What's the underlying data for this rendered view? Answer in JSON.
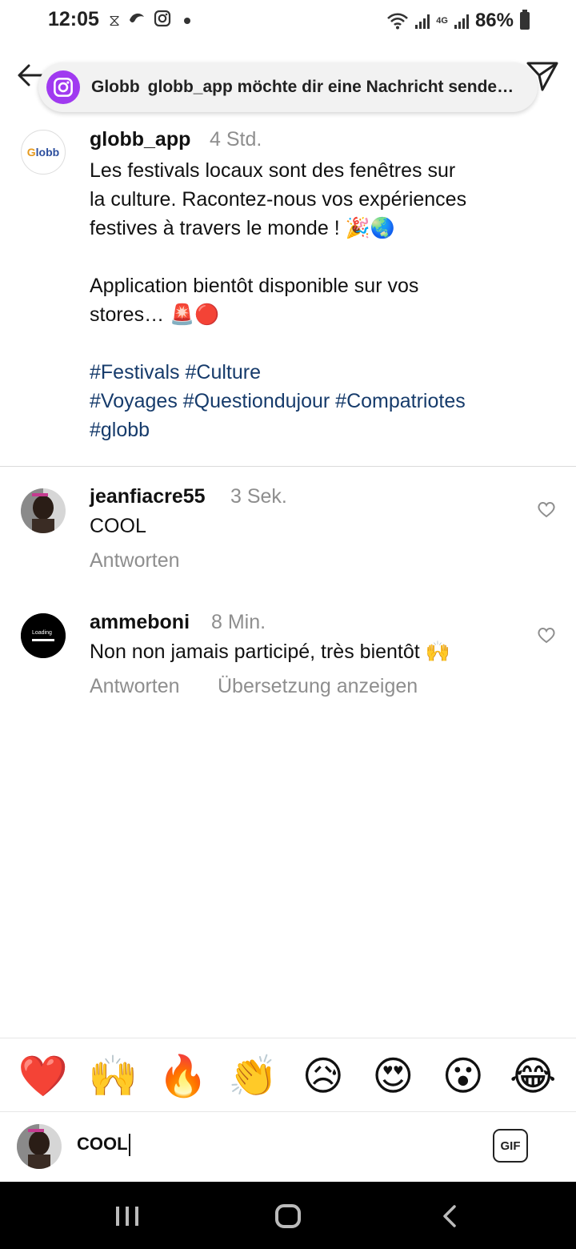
{
  "status_bar": {
    "time": "12:05",
    "battery": "86%",
    "network": "4G",
    "left_icons": [
      "hourglass-icon",
      "bird-icon",
      "instagram-icon",
      "dot-icon"
    ]
  },
  "header": {
    "notification_app": "Globb",
    "notification_message": "globb_app möchte dir eine Nachricht sende…"
  },
  "post": {
    "username": "globb_app",
    "time": "4 Std.",
    "avatar_text": "Globb",
    "lines": [
      "Les festivals locaux sont des fenêtres sur",
      "la culture. Racontez-nous vos expériences",
      "festives à travers le monde ! 🎉🌏",
      "",
      "Application bientôt disponible sur vos",
      "stores… 🚨🔴"
    ],
    "hashtag_lines": [
      "#Festivals #Culture",
      "#Voyages #Questiondujour #Compatriotes",
      "#globb"
    ]
  },
  "comments": [
    {
      "username": "jeanfiacre55",
      "time": "3 Sek.",
      "text": "COOL",
      "reply": "Antworten",
      "translate": ""
    },
    {
      "username": "ammeboni",
      "time": "8 Min.",
      "text": "Non non jamais participé, très bientôt 🙌",
      "reply": "Antworten",
      "translate": "Übersetzung anzeigen",
      "avatar_text": "Loading"
    }
  ],
  "emoji_reactions": [
    "❤️",
    "🙌",
    "🔥",
    "👏",
    "😥",
    "😍",
    "😮",
    "😂"
  ],
  "composer": {
    "value": "COOL",
    "gif_label": "GIF"
  },
  "colors": {
    "hashtag": "#163b6b",
    "meta_gray": "#8e8e8e",
    "instagram_badge": "#a03af0"
  }
}
